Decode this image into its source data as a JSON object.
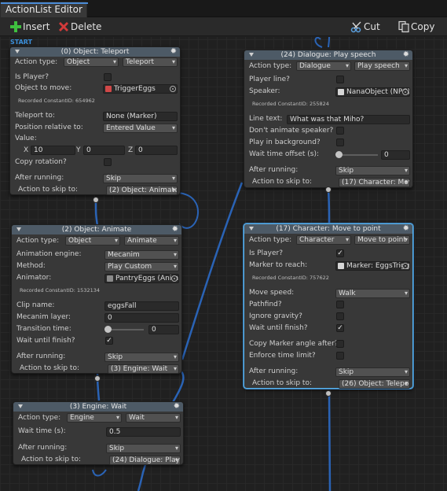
{
  "window": {
    "tab": "ActionList Editor"
  },
  "toolbar": {
    "insert": "Insert",
    "delete": "Delete",
    "cut": "Cut",
    "copy": "Copy"
  },
  "canvas": {
    "start_label": "START"
  },
  "colors": {
    "accent": "#4a8bd6",
    "node_header": "#4d5a66",
    "node_body": "#383838",
    "selected_border": "#5ab0e6",
    "connection": "#2a63b5",
    "insert_icon": "#3fbf3f",
    "delete_icon": "#d23a3a"
  },
  "nodes": {
    "teleport": {
      "title": "(0) Object: Teleport",
      "action_type_label": "Action type:",
      "action_cat": "Object",
      "action_name": "Teleport",
      "is_player_label": "Is Player?",
      "is_player": false,
      "object_to_move_label": "Object to move:",
      "object_to_move": "TriggerEggs",
      "constant_id": "Recorded ConstantID: 654962",
      "teleport_to_label": "Teleport to:",
      "teleport_to": "None (Marker)",
      "position_relative_label": "Position relative to:",
      "position_relative": "Entered Value",
      "value_label": "Value:",
      "x_label": "X",
      "x": "10",
      "y_label": "Y",
      "y": "0",
      "z_label": "Z",
      "z": "0",
      "copy_rotation_label": "Copy rotation?",
      "copy_rotation": false,
      "after_running_label": "After running:",
      "after_running": "Skip",
      "skip_to_label": "Action to skip to:",
      "skip_to": "(2) Object: Animate"
    },
    "animate": {
      "title": "(2) Object: Animate",
      "action_type_label": "Action type:",
      "action_cat": "Object",
      "action_name": "Animate",
      "engine_label": "Animation engine:",
      "engine": "Mecanim",
      "method_label": "Method:",
      "method": "Play Custom",
      "animator_label": "Animator:",
      "animator": "PantryEggs (Animator)",
      "constant_id": "Recorded ConstantID: 1532134",
      "clip_label": "Clip name:",
      "clip": "eggsFall",
      "layer_label": "Mecanim layer:",
      "layer": "0",
      "transition_label": "Transition time:",
      "transition": "0",
      "wait_label": "Wait until finish?",
      "wait": true,
      "after_running_label": "After running:",
      "after_running": "Skip",
      "skip_to_label": "Action to skip to:",
      "skip_to": "(3) Engine: Wait"
    },
    "wait": {
      "title": "(3) Engine: Wait",
      "action_type_label": "Action type:",
      "action_cat": "Engine",
      "action_name": "Wait",
      "wait_time_label": "Wait time (s):",
      "wait_time": "0.5",
      "after_running_label": "After running:",
      "after_running": "Skip",
      "skip_to_label": "Action to skip to:",
      "skip_to": "(24) Dialogue: Play speech"
    },
    "dialogue": {
      "title": "(24) Dialogue: Play speech",
      "action_type_label": "Action type:",
      "action_cat": "Dialogue",
      "action_name": "Play speech",
      "player_line_label": "Player line?",
      "player_line": false,
      "speaker_label": "Speaker:",
      "speaker": "NanaObject (NPC)",
      "constant_id": "Recorded ConstantID: 255824",
      "line_text_label": "Line text:",
      "line_text": "What was that Miho?",
      "dont_animate_label": "Don't animate speaker?",
      "dont_animate": false,
      "play_bg_label": "Play in background?",
      "play_bg": false,
      "wait_offset_label": "Wait time offset (s):",
      "wait_offset": "0",
      "after_running_label": "After running:",
      "after_running": "Skip",
      "skip_to_label": "Action to skip to:",
      "skip_to": "(17) Character: Move to point"
    },
    "move": {
      "title": "(17) Character: Move to point",
      "action_type_label": "Action type:",
      "action_cat": "Character",
      "action_name": "Move to point",
      "is_player_label": "Is Player?",
      "is_player": true,
      "marker_label": "Marker to reach:",
      "marker": "Marker: EggsTrigger",
      "constant_id": "Recorded ConstantID: 757622",
      "speed_label": "Move speed:",
      "speed": "Walk",
      "pathfind_label": "Pathfind?",
      "pathfind": false,
      "gravity_label": "Ignore gravity?",
      "gravity": false,
      "wait_label": "Wait until finish?",
      "wait": true,
      "copy_angle_label": "Copy Marker angle after?",
      "copy_angle": false,
      "time_limit_label": "Enforce time limit?",
      "time_limit": false,
      "after_running_label": "After running:",
      "after_running": "Skip",
      "skip_to_label": "Action to skip to:",
      "skip_to": "(26) Object: Teleport"
    }
  }
}
